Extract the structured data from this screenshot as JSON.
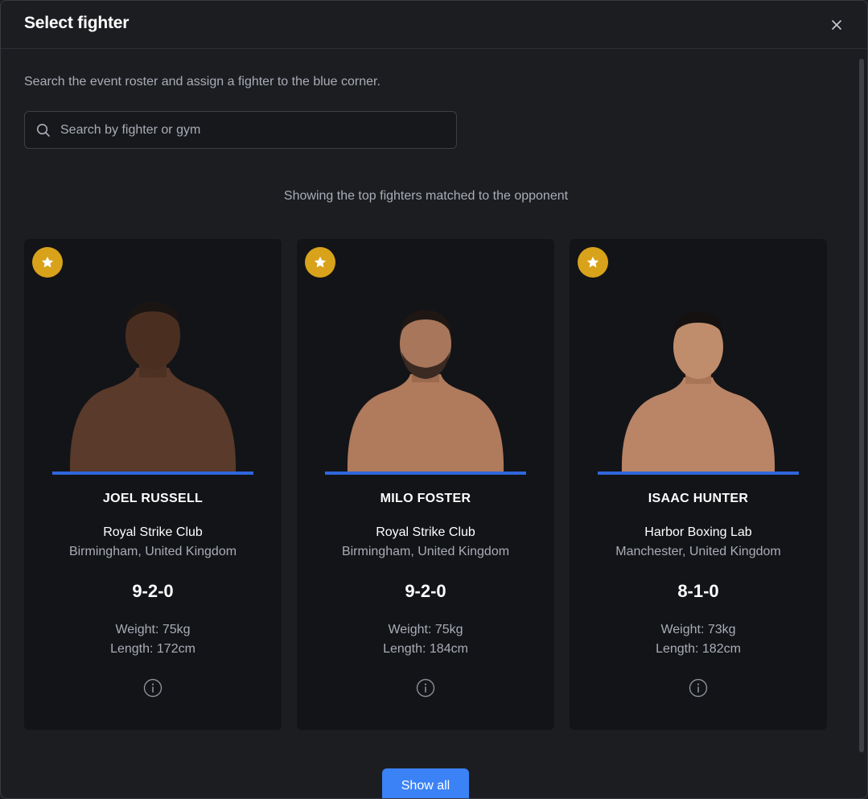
{
  "modal": {
    "title": "Select fighter",
    "intro": "Search the event roster and assign a fighter to the blue corner.",
    "subtitle": "Showing the top fighters matched to the opponent",
    "show_all_label": "Show all"
  },
  "search": {
    "placeholder": "Search by fighter or gym",
    "value": ""
  },
  "colors": {
    "accent": "#3b82f6",
    "corner_blue": "#2f66dc",
    "badge_gold": "#d8a21a"
  },
  "fighters": [
    {
      "name": "JOEL RUSSELL",
      "gym": "Royal Strike Club",
      "location": "Birmingham, United Kingdom",
      "record": "9-2-0",
      "weight": "Weight: 75kg",
      "length": "Length: 172cm",
      "featured_icon": "star-icon",
      "info_icon": "info-icon"
    },
    {
      "name": "MILO FOSTER",
      "gym": "Royal Strike Club",
      "location": "Birmingham, United Kingdom",
      "record": "9-2-0",
      "weight": "Weight: 75kg",
      "length": "Length: 184cm",
      "featured_icon": "star-icon",
      "info_icon": "info-icon"
    },
    {
      "name": "ISAAC HUNTER",
      "gym": "Harbor Boxing Lab",
      "location": "Manchester, United Kingdom",
      "record": "8-1-0",
      "weight": "Weight: 73kg",
      "length": "Length: 182cm",
      "featured_icon": "star-icon",
      "info_icon": "info-icon"
    }
  ]
}
